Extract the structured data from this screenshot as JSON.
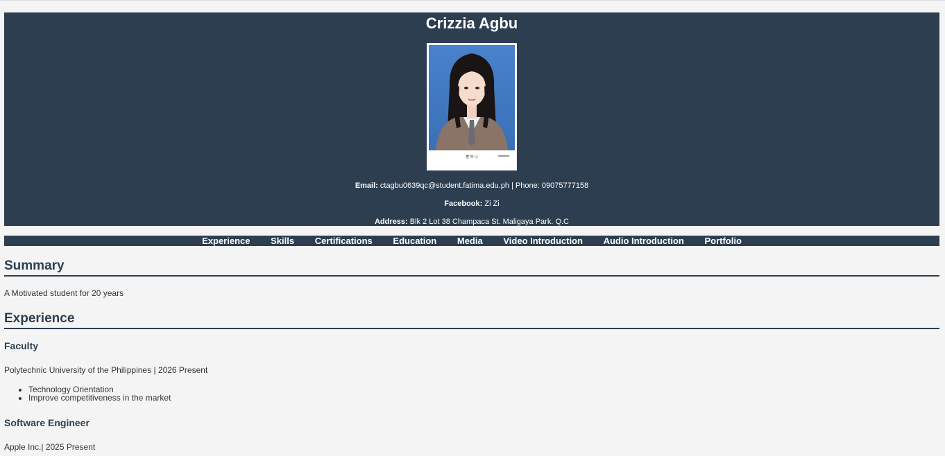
{
  "profile": {
    "name": "Crizzia Agbu",
    "email_label": "Email:",
    "email": "ctagbu0639qc@student.fatima.edu.ph",
    "phone_label": "| Phone:",
    "phone": "09075777158",
    "facebook_label": "Facebook:",
    "facebook": "Zi Zi",
    "address_label": "Address:",
    "address": "Blk 2 Lot 38 Champaca St. Maligaya Park. Q.C",
    "photo_caption": "할 하 나"
  },
  "nav": {
    "items": [
      {
        "label": "Experience"
      },
      {
        "label": "Skills"
      },
      {
        "label": "Certifications"
      },
      {
        "label": "Education"
      },
      {
        "label": "Media"
      },
      {
        "label": "Video Introduction"
      },
      {
        "label": "Audio Introduction"
      },
      {
        "label": "Portfolio"
      }
    ]
  },
  "summary": {
    "title": "Summary",
    "text": "A Motivated student for 20 years"
  },
  "experience": {
    "title": "Experience",
    "jobs": [
      {
        "title": "Faculty",
        "details": "Polytechnic University of the Philippines | 2026 Present",
        "duties": [
          "Technology Orientation",
          "Improve competitiveness in the market"
        ]
      },
      {
        "title": "Software Engineer",
        "details": "Apple Inc.| 2025 Present"
      }
    ]
  },
  "colors": {
    "header_bg": "#2c3e50",
    "page_bg": "#f4f4f4",
    "text": "#333333"
  }
}
